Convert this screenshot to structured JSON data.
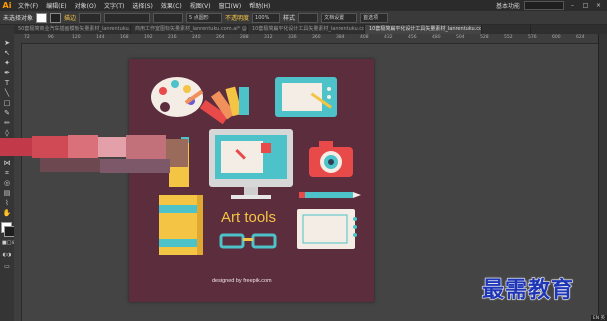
{
  "app": {
    "logo": "Ai"
  },
  "menubar": {
    "items": [
      "文件(F)",
      "编辑(E)",
      "对象(O)",
      "文字(T)",
      "选择(S)",
      "效果(C)",
      "视图(V)",
      "窗口(W)",
      "帮助(H)"
    ],
    "workspace": "基本功能",
    "window_buttons": [
      "–",
      "□",
      "×"
    ]
  },
  "control_bar": {
    "selection_label": "未选择对象",
    "stroke_label": "描边",
    "stroke_value": "",
    "brush_value": "5 点圆形",
    "opacity_label": "不透明度",
    "opacity_value": "100%",
    "style_label": "样式",
    "doc_settings": "文档设置",
    "preferences": "首选项"
  },
  "tabs": [
    {
      "label": "50套极简商业汽车插画模板矢量素材_lanrentuku.com.ai* @ 66.67%",
      "active": false
    },
    {
      "label": "商用工作室图标矢量素材_lanrentuku.com.ai* @ 66.67%",
      "active": false
    },
    {
      "label": "10套极简扁平化设计工具矢量素材_lanrentuku.com.ai* @ 66.67% (RGB/预览)",
      "active": true
    },
    {
      "label": "10套极简扁平化设计工具矢量素材_lanrentuku.com.ai* @ 66.67%",
      "active": false
    },
    {
      "label": "",
      "active": false
    }
  ],
  "ruler": {
    "ticks": [
      "72",
      "96",
      "120",
      "144",
      "168",
      "192",
      "216",
      "240",
      "264",
      "288",
      "312",
      "336",
      "360",
      "384",
      "408",
      "432",
      "456",
      "480",
      "504",
      "528",
      "552",
      "576",
      "600",
      "624"
    ]
  },
  "artwork": {
    "title": "Art tools",
    "credit": "designed by  freepik.com",
    "colors": {
      "background": "#5c2d3d",
      "yellow": "#f4c444",
      "teal": "#4dc3c9",
      "red": "#e84a4a",
      "cream": "#f3ede6"
    }
  },
  "status": {
    "lang": "EN 英"
  },
  "watermark": "最需教育",
  "icons": [
    "selection-tool-icon",
    "direct-selection-icon",
    "magic-wand-icon",
    "pen-tool-icon",
    "type-tool-icon",
    "line-tool-icon",
    "rectangle-tool-icon",
    "paintbrush-icon",
    "pencil-icon",
    "eraser-icon",
    "rotate-icon",
    "scale-icon",
    "width-icon",
    "free-transform-icon",
    "shape-builder-icon",
    "perspective-icon",
    "mesh-icon",
    "gradient-icon",
    "eyedropper-icon",
    "blend-icon",
    "symbol-sprayer-icon",
    "graph-icon",
    "artboard-icon",
    "slice-icon",
    "hand-icon",
    "zoom-icon"
  ]
}
